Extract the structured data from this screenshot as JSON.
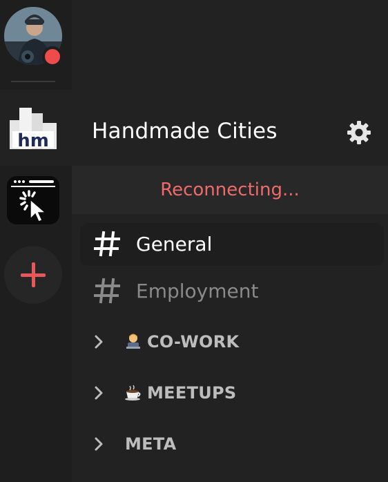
{
  "rail": {
    "avatar_icon": "user-avatar",
    "status_color": "#ee4b4b",
    "servers": [
      {
        "icon": "handmade-cities-logo",
        "logo_text": "hm"
      },
      {
        "icon": "cursor-click-logo"
      }
    ],
    "add_server_icon": "plus-icon",
    "accent": "#e8575a"
  },
  "panel": {
    "server_name": "Handmade Cities",
    "settings_icon": "gear-icon",
    "status_banner": "Reconnecting...",
    "status_color": "#ef6b6b",
    "channels": [
      {
        "name": "General",
        "active": true
      },
      {
        "name": "Employment",
        "active": false
      }
    ],
    "categories": [
      {
        "emoji": "technologist",
        "label": "CO-WORK"
      },
      {
        "emoji": "coffee",
        "label": "MEETUPS"
      },
      {
        "emoji": "",
        "label": "META"
      }
    ]
  }
}
